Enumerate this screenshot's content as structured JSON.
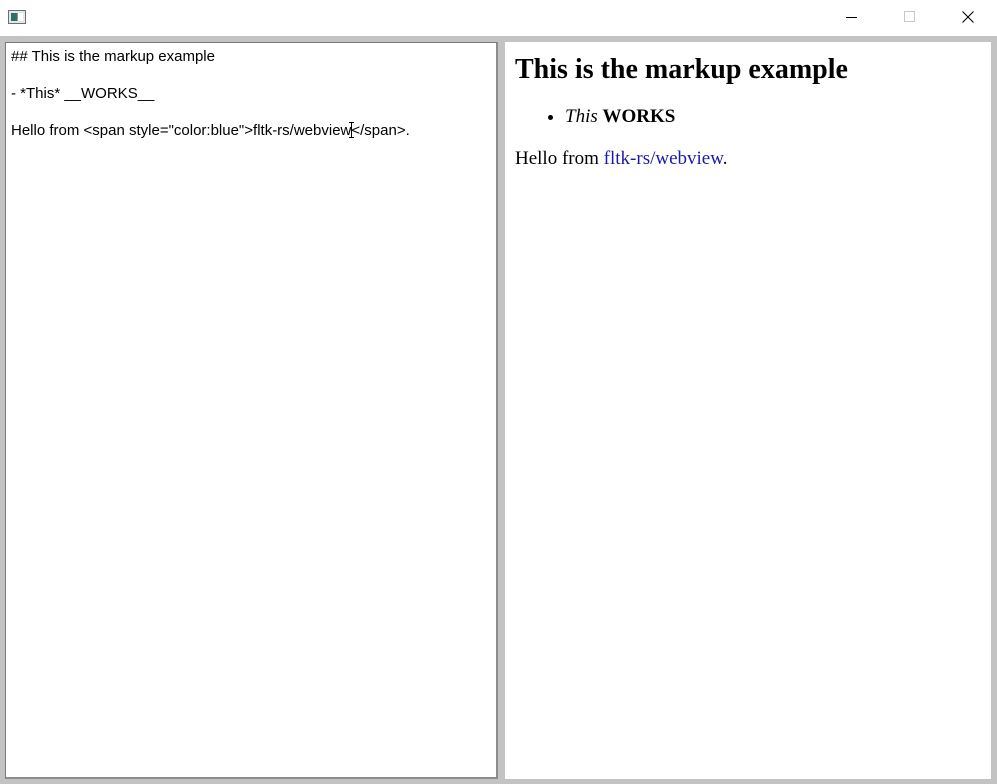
{
  "window": {
    "controls": {
      "minimize_icon": "minimize-icon",
      "maximize_icon": "maximize-icon",
      "close_icon": "close-icon"
    }
  },
  "editor": {
    "lines": [
      "## This is the markup example",
      "- *This* __WORKS__",
      "Hello from <span style=\"color:blue\">fltk-rs/webview"
    ],
    "line3_tail": "</span>."
  },
  "preview": {
    "heading": "This is the markup example",
    "list_item_em": "This",
    "list_item_strong": "WORKS",
    "para_prefix": "Hello from ",
    "para_span": "fltk-rs/webview",
    "para_suffix": ".",
    "span_color": "#1a1aa6"
  }
}
